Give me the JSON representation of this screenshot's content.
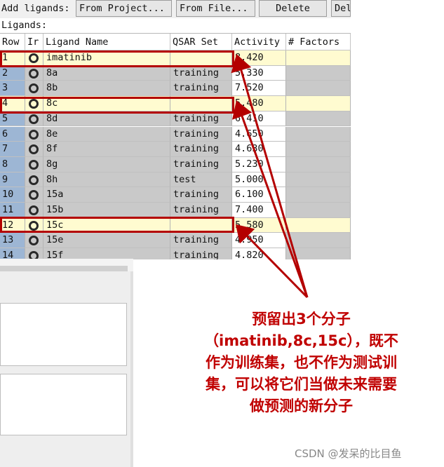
{
  "toolbar": {
    "add_label": "Add ligands:",
    "from_project": "From Project...",
    "from_file": "From File...",
    "delete": "Delete",
    "delete_all": "Del"
  },
  "section_label": "Ligands:",
  "table": {
    "headers": [
      "Row",
      "Ir",
      "Ligand Name",
      "QSAR Set",
      "Activity",
      "# Factors"
    ],
    "rows": [
      {
        "row": "1",
        "name": "imatinib",
        "set": "",
        "activity": "8.420",
        "highlight": true
      },
      {
        "row": "2",
        "name": "8a",
        "set": "training",
        "activity": "5.330",
        "highlight": false
      },
      {
        "row": "3",
        "name": "8b",
        "set": "training",
        "activity": "7.520",
        "highlight": false
      },
      {
        "row": "4",
        "name": "8c",
        "set": "",
        "activity": "5.480",
        "highlight": true
      },
      {
        "row": "5",
        "name": "8d",
        "set": "training",
        "activity": "6.410",
        "highlight": false
      },
      {
        "row": "6",
        "name": "8e",
        "set": "training",
        "activity": "4.650",
        "highlight": false
      },
      {
        "row": "7",
        "name": "8f",
        "set": "training",
        "activity": "4.630",
        "highlight": false
      },
      {
        "row": "8",
        "name": "8g",
        "set": "training",
        "activity": "5.230",
        "highlight": false
      },
      {
        "row": "9",
        "name": "8h",
        "set": "test",
        "activity": "5.000",
        "highlight": false
      },
      {
        "row": "10",
        "name": "15a",
        "set": "training",
        "activity": "6.100",
        "highlight": false
      },
      {
        "row": "11",
        "name": "15b",
        "set": "training",
        "activity": "7.400",
        "highlight": false
      },
      {
        "row": "12",
        "name": "15c",
        "set": "",
        "activity": "5.580",
        "highlight": true
      },
      {
        "row": "13",
        "name": "15e",
        "set": "training",
        "activity": "4.950",
        "highlight": false
      },
      {
        "row": "14",
        "name": "15f",
        "set": "training",
        "activity": "4.820",
        "highlight": false
      }
    ]
  },
  "annotation": {
    "lines": [
      "预留出3个分子",
      "（imatinib,8c,15c），既不",
      "作为训练集，也不作为测试训",
      "集，可以将它们当做未来需要",
      "做预测的新分子"
    ],
    "color": "#c00000"
  },
  "watermark": "CSDN @发呆的比目鱼"
}
